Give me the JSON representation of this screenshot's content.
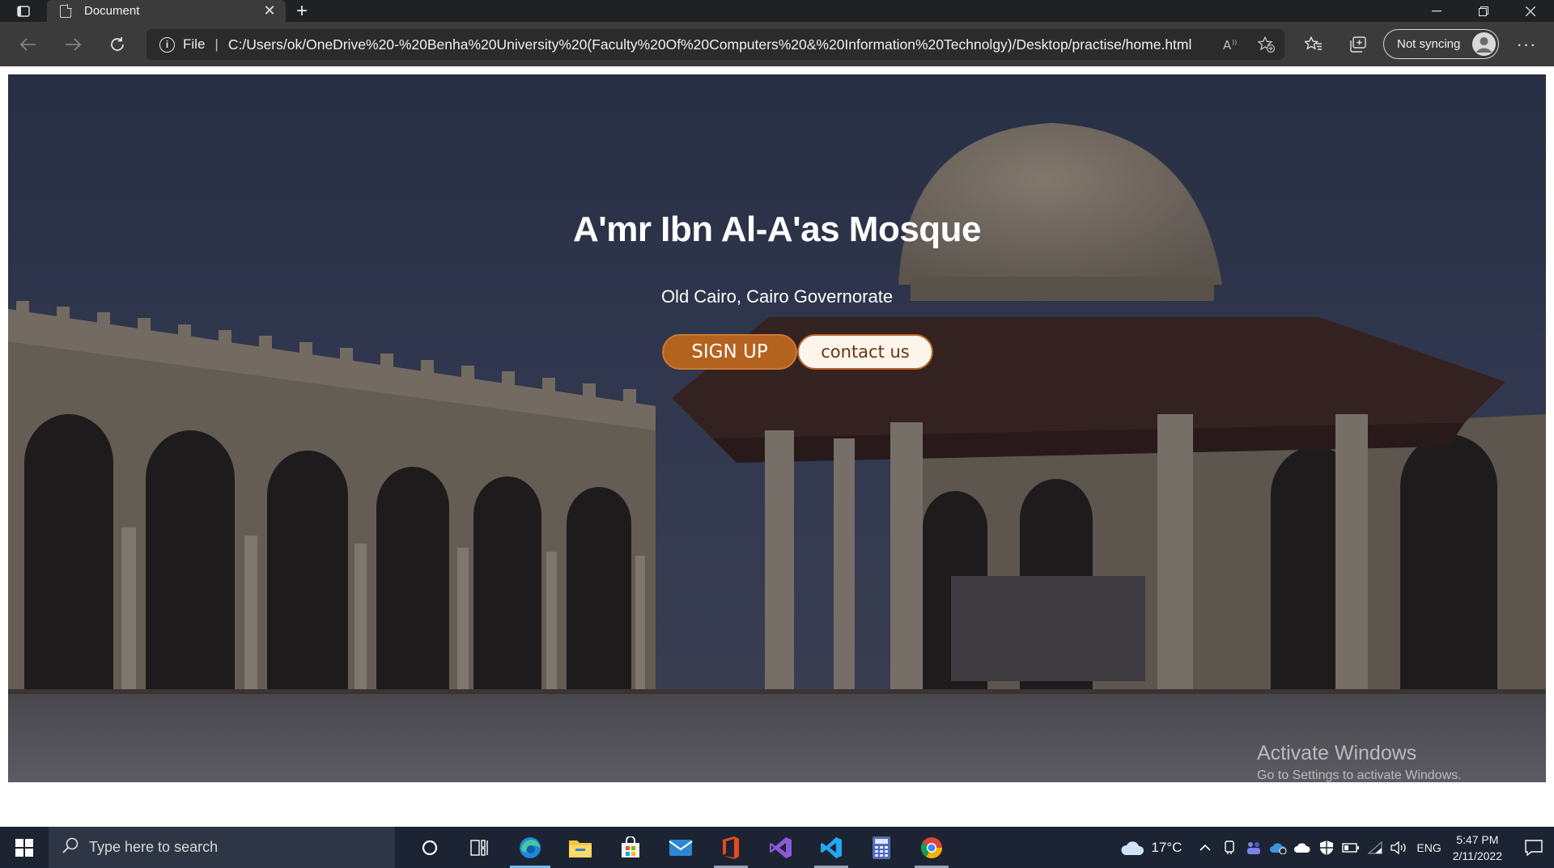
{
  "browser": {
    "tab_title": "Document",
    "address_scheme_label": "File",
    "url": "C:/Users/ok/OneDrive%20-%20Benha%20University%20(Faculty%20Of%20Computers%20&%20Information%20Technolgy)/Desktop/practise/home.html",
    "sync_label": "Not syncing"
  },
  "hero": {
    "title": "A'mr Ibn Al-A'as Mosque",
    "subtitle": "Old Cairo, Cairo Governorate",
    "signup_label": "SIGN UP",
    "contact_label": "contact us"
  },
  "watermark": {
    "title": "Activate Windows",
    "subtitle": "Go to Settings to activate Windows."
  },
  "taskbar": {
    "search_placeholder": "Type here to search",
    "weather_temp": "17°C",
    "language": "ENG",
    "time": "5:47 PM",
    "date": "2/11/2022"
  },
  "colors": {
    "signup_bg": "#b5621f",
    "contact_bg": "#fbf5ec",
    "contact_text": "#6b3410",
    "chrome_bg": "#3b3b3b",
    "taskbar_bg": "#1c2433"
  }
}
